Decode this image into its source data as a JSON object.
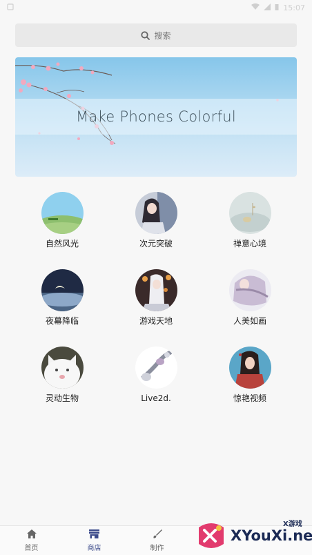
{
  "status_bar": {
    "time": "15:07"
  },
  "search": {
    "label": "搜索"
  },
  "banner": {
    "text": "Make Phones Colorful"
  },
  "categories": [
    {
      "label": "自然风光",
      "icon": "nature-scenery-thumbnail"
    },
    {
      "label": "次元突破",
      "icon": "anime-girl-thumbnail"
    },
    {
      "label": "禅意心境",
      "icon": "zen-thumbnail"
    },
    {
      "label": "夜幕降临",
      "icon": "night-moon-thumbnail"
    },
    {
      "label": "游戏天地",
      "icon": "game-character-thumbnail"
    },
    {
      "label": "人美如画",
      "icon": "beauty-portrait-thumbnail"
    },
    {
      "label": "灵动生物",
      "icon": "kitten-thumbnail"
    },
    {
      "label": "Live2d.",
      "icon": "live2d-thumbnail"
    },
    {
      "label": "惊艳视频",
      "icon": "video-portrait-thumbnail"
    }
  ],
  "bottom_nav": {
    "items": [
      {
        "label": "首页",
        "icon": "home-icon",
        "active": false
      },
      {
        "label": "商店",
        "icon": "store-icon",
        "active": true
      },
      {
        "label": "制作",
        "icon": "brush-icon",
        "active": false
      }
    ]
  },
  "watermark": {
    "brand": "XYouXi.net",
    "tag": "X游戏"
  },
  "colors": {
    "active_nav": "#3b4a8a",
    "background": "#f7f7f7"
  }
}
